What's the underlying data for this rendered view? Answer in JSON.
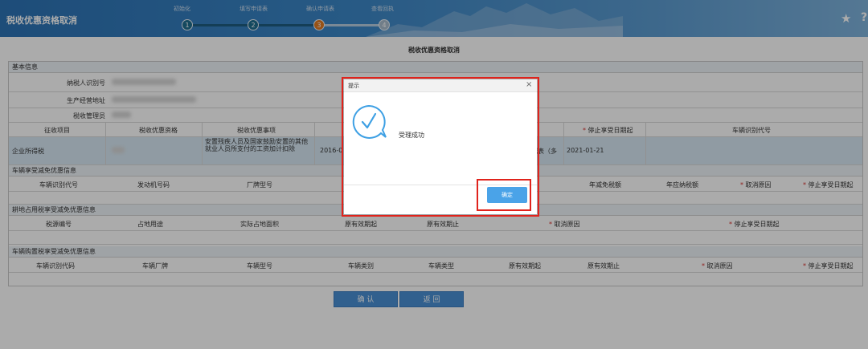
{
  "app": {
    "title": "税收优惠资格取消"
  },
  "steps": [
    {
      "num": "1",
      "label": "初始化"
    },
    {
      "num": "2",
      "label": "填写申请表"
    },
    {
      "num": "3",
      "label": "确认申请表"
    },
    {
      "num": "4",
      "label": "查看回执"
    }
  ],
  "form": {
    "title": "税收优惠资格取消",
    "basic": {
      "header": "基本信息",
      "taxpayer_id_label": "纳税人识别号",
      "address_label": "生产经营地址",
      "tax_authority_label": "税收管理员"
    },
    "benefit_table": {
      "headers": [
        "征收项目",
        "税收优惠资格",
        "税收优惠事项",
        "停止享受日期起",
        "车辆识别代号"
      ],
      "row": {
        "item": "企业所得税",
        "matter": "安置残疾人员及国家鼓励安置的其他就业人员所支付的工资加计扣除",
        "start_partial": "2016-0",
        "reason_partial": "据表（多",
        "stop_date": "2021-01-21"
      }
    },
    "vehicle_section": {
      "header": "车辆享受减免优惠信息",
      "headers": [
        "车辆识别代号",
        "发动机号码",
        "厂牌型号",
        "年减免税额",
        "年应纳税额",
        "取消原因",
        "停止享受日期起"
      ]
    },
    "land_section": {
      "header": "耕地占用税享受减免优惠信息",
      "headers": [
        "税源编号",
        "占地用途",
        "实际占地面积",
        "原有效期起",
        "原有效期止",
        "取消原因",
        "停止享受日期起"
      ]
    },
    "purchase_section": {
      "header": "车辆购置税享受减免优惠信息",
      "headers": [
        "车辆识别代码",
        "车辆厂牌",
        "车辆型号",
        "车辆类别",
        "车辆类型",
        "原有效期起",
        "原有效期止",
        "取消原因",
        "停止享受日期起"
      ]
    },
    "confirm_label": "确 认",
    "back_label": "返 回"
  },
  "modal": {
    "title": "提示",
    "close": "×",
    "message": "受理成功",
    "ok_label": "确定"
  },
  "header_icons": {
    "star": "★",
    "help": "?"
  },
  "colors": {
    "accent": "#4a90d4",
    "highlight": "#e0231c",
    "step_done": "#1f6d8e",
    "step_current": "#e07b22"
  }
}
